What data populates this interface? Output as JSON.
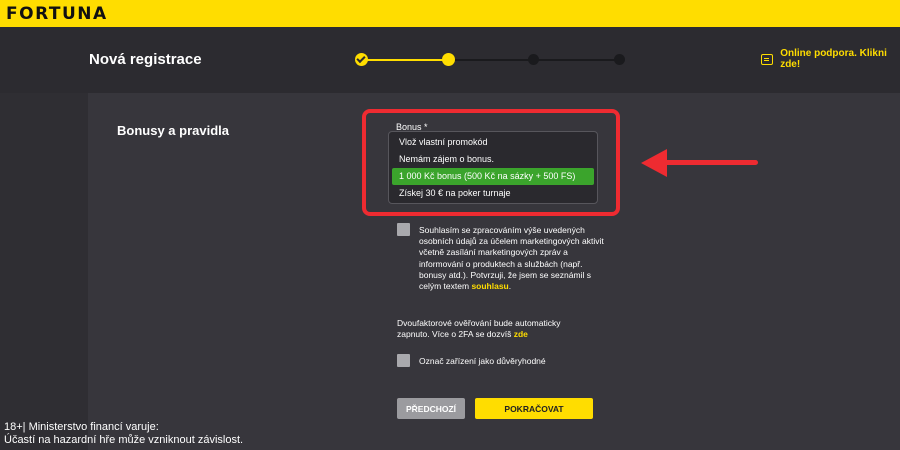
{
  "brand": {
    "logo_text": "FORTUNA",
    "accent": "#ffdd00"
  },
  "header": {
    "title": "Nová registrace",
    "support_text": "Online podpora. Klikni zde!",
    "support_icon": "chat-icon",
    "steps": [
      {
        "state": "done"
      },
      {
        "state": "current"
      },
      {
        "state": "todo"
      },
      {
        "state": "todo"
      }
    ]
  },
  "section": {
    "title": "Bonusy a pravidla"
  },
  "bonus": {
    "label": "Bonus *",
    "options": [
      {
        "label": "Vlož vlastní promokód"
      },
      {
        "label": "Nemám zájem o bonus."
      },
      {
        "label": "1 000 Kč bonus (500 Kč na sázky + 500 FS)"
      },
      {
        "label": "Získej 30 € na poker turnaje"
      }
    ],
    "selected_index": 2,
    "selected_color": "#3ba42c"
  },
  "consent": {
    "text": "Souhlasím se zpracováním výše uvedených osobních údajů za účelem marketingových aktivit včetně zasílání marketingových zpráv a informování o produktech a službách (např. bonusy atd.). Potvrzuji, že jsem se seznámil s celým textem ",
    "link": "souhlasu",
    "suffix": "."
  },
  "twofa": {
    "text": "Dvoufaktorové ověřování bude automaticky zapnuto. Více o 2FA se dozvíš ",
    "link": "zde"
  },
  "trust": {
    "label": "Označ zařízení jako důvěryhodné"
  },
  "buttons": {
    "back": "PŘEDCHOZÍ",
    "next": "POKRAČOVAT"
  },
  "disclaimer": {
    "line1": "18+| Ministerstvo financí varuje:",
    "line2": "Účastí na hazardní hře může vzniknout závislost."
  },
  "annotation_color": "#ee2b31"
}
